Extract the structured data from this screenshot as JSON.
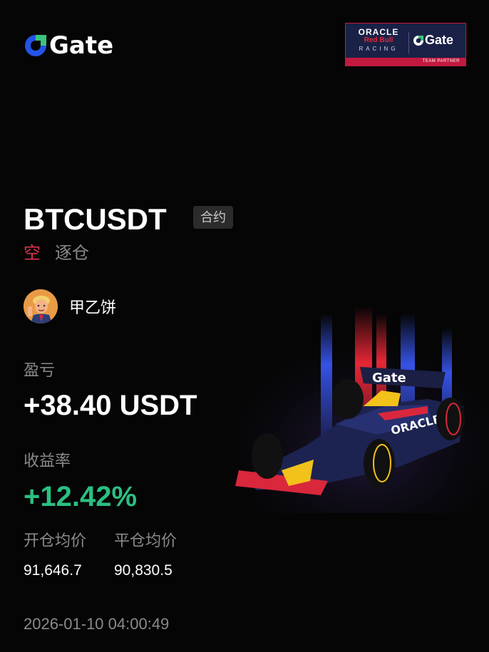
{
  "brand": {
    "name": "Gate",
    "accent_color": "#2354e6"
  },
  "partner_badge": {
    "line1": "ORACLE",
    "line2": "Red Bull",
    "line3": "RACING",
    "brand": "Gate",
    "footer": "TEAM PARTNER",
    "color": "#c2193f"
  },
  "position": {
    "symbol": "BTCUSDT",
    "tag": "合约",
    "direction": "空",
    "direction_color": "#e0334d",
    "margin_mode": "逐仓"
  },
  "user": {
    "name": "甲乙饼"
  },
  "pnl": {
    "label": "盈亏",
    "value": "+38.40 USDT"
  },
  "roi": {
    "label": "收益率",
    "value": "+12.42%",
    "color": "#2bbf82"
  },
  "prices": {
    "open_label": "开仓均价",
    "close_label": "平仓均价",
    "open_value": "91,646.7",
    "close_value": "90,830.5"
  },
  "timestamp": "2026-01-10 04:00:49"
}
